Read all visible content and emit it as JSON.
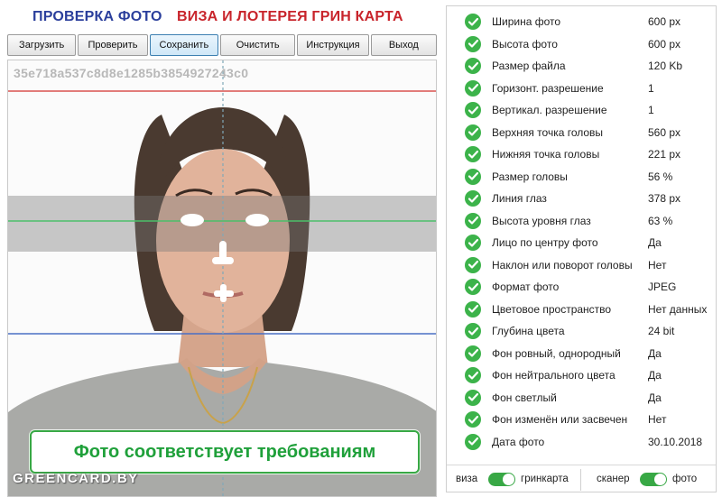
{
  "header": {
    "title_left": "ПРОВЕРКА ФОТО",
    "title_right": "ВИЗА И ЛОТЕРЕЯ ГРИН КАРТА"
  },
  "toolbar": {
    "buttons": [
      "Загрузить",
      "Проверить",
      "Сохранить",
      "Очистить",
      "Инструкция",
      "Выход"
    ],
    "active": "Сохранить"
  },
  "photo": {
    "hash": "35e718a537c8d8e1285b3854927243c0",
    "result_text": "Фото соответствует требованиям",
    "watermark": "GREENCARD.BY"
  },
  "checks": [
    {
      "label": "Ширина фото",
      "value": "600 px"
    },
    {
      "label": "Высота фото",
      "value": "600 px"
    },
    {
      "label": "Размер файла",
      "value": "120 Kb"
    },
    {
      "label": "Горизонт. разрешение",
      "value": "1"
    },
    {
      "label": "Вертикал. разрешение",
      "value": "1"
    },
    {
      "label": "Верхняя точка головы",
      "value": "560 px"
    },
    {
      "label": "Нижняя точка головы",
      "value": "221 px"
    },
    {
      "label": "Размер головы",
      "value": "56 %"
    },
    {
      "label": "Линия глаз",
      "value": "378 px"
    },
    {
      "label": "Высота уровня глаз",
      "value": "63 %"
    },
    {
      "label": "Лицо по центру фото",
      "value": "Да"
    },
    {
      "label": "Наклон или поворот головы",
      "value": "Нет"
    },
    {
      "label": "Формат фото",
      "value": "JPEG"
    },
    {
      "label": "Цветовое пространство",
      "value": "Нет данных"
    },
    {
      "label": "Глубина цвета",
      "value": "24 bit"
    },
    {
      "label": "Фон ровный, однородный",
      "value": "Да"
    },
    {
      "label": "Фон нейтрального цвета",
      "value": "Да"
    },
    {
      "label": "Фон светлый",
      "value": "Да"
    },
    {
      "label": "Фон изменён или засвечен",
      "value": "Нет"
    },
    {
      "label": "Дата фото",
      "value": "30.10.2018"
    }
  ],
  "toggles": {
    "left_off": "виза",
    "left_on": "гринкарта",
    "right_off": "сканер",
    "right_on": "фото"
  },
  "colors": {
    "title_blue": "#2b3f9c",
    "title_red": "#c8242b",
    "ok_green": "#3cb34a",
    "guide_red": "#d9534f",
    "guide_green": "#4cbf6a",
    "guide_blue": "#4a6fc4"
  }
}
